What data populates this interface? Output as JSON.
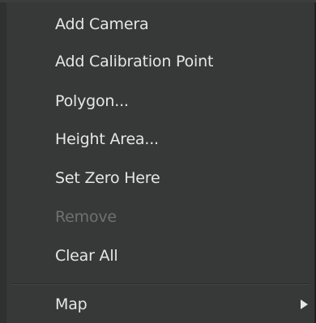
{
  "menu": {
    "items": [
      {
        "label": "Add Camera",
        "enabled": true
      },
      {
        "label": "Add Calibration Point",
        "enabled": true
      },
      {
        "label": "Polygon...",
        "enabled": true
      },
      {
        "label": "Height Area...",
        "enabled": true
      },
      {
        "label": "Set Zero Here",
        "enabled": true
      },
      {
        "label": "Remove",
        "enabled": false
      },
      {
        "label": "Clear All",
        "enabled": true
      }
    ],
    "submenu": {
      "label": "Map",
      "icon": "submenu-arrow-icon"
    }
  }
}
